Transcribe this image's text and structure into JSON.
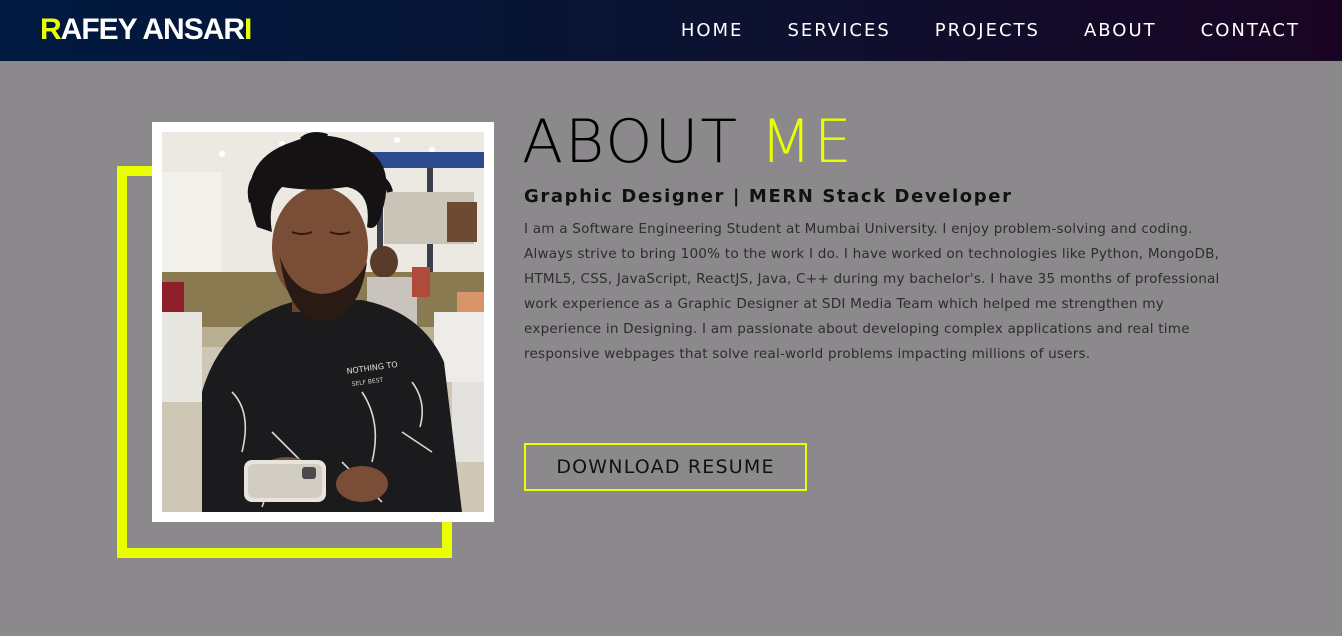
{
  "nav": {
    "brand": {
      "first_letter": "R",
      "middle": "AFEY ANSAR",
      "last_letter": "I"
    },
    "links": [
      "HOME",
      "SERVICES",
      "PROJECTS",
      "ABOUT",
      "CONTACT"
    ]
  },
  "about": {
    "title_main": "ABOUT",
    "title_accent": "ME",
    "subtitle": "Graphic Designer | MERN Stack Developer",
    "body": "I am a Software Engineering Student at Mumbai University. I enjoy problem-solving and coding. Always strive to bring 100% to the work I do. I have worked on technologies like Python, MongoDB, HTML5, CSS, JavaScript, ReactJS, Java, C++ during my bachelor's. I have 35 months of professional work experience as a Graphic Designer at SDI Media Team which helped me strengthen my experience in Designing. I am passionate about developing complex applications and real time responsive webpages that solve real-world problems impacting millions of users.",
    "resume_button": "DOWNLOAD RESUME"
  },
  "colors": {
    "accent": "#e9ff00",
    "nav_bg_start": "#001a40",
    "nav_bg_end": "#1a0423",
    "page_bg": "#8b898b"
  }
}
